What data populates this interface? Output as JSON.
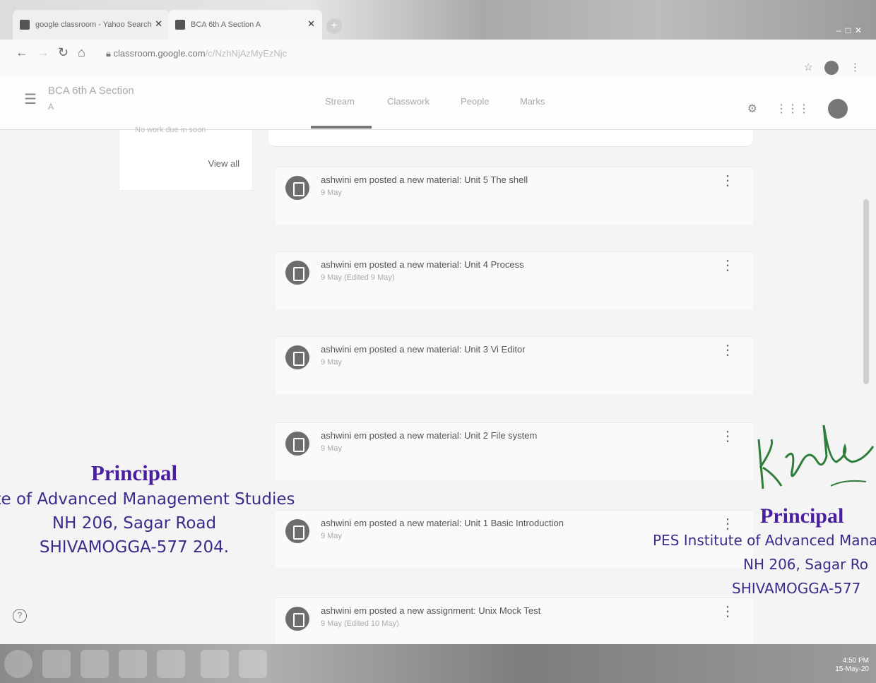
{
  "browser": {
    "tabs": [
      {
        "label": "google classroom - Yahoo Search"
      },
      {
        "label": "BCA 6th A Section A"
      }
    ],
    "url_host": "classroom.google.com",
    "url_path": "/c/NzhNjAzMyEzNjc"
  },
  "header": {
    "class_title": "BCA 6th A Section",
    "class_subtitle": "A",
    "tabs": [
      "Stream",
      "Classwork",
      "People",
      "Marks"
    ]
  },
  "upcoming": {
    "no_work": "No work due in soon",
    "view_all": "View all"
  },
  "posts": [
    {
      "text": "ashwini em posted a new material: Unit 5 The shell",
      "date": "9 May"
    },
    {
      "text": "ashwini em posted a new material: Unit 4 Process",
      "date": "9 May (Edited 9 May)"
    },
    {
      "text": "ashwini em posted a new material: Unit 3 Vi Editor",
      "date": "9 May"
    },
    {
      "text": "ashwini em posted a new material: Unit 2 File system",
      "date": "9 May"
    },
    {
      "text": "ashwini em posted a new material: Unit 1 Basic Introduction",
      "date": "9 May"
    },
    {
      "text": "ashwini em posted a new assignment: Unix Mock Test",
      "date": "9 May (Edited 10 May)"
    }
  ],
  "stamp_left": {
    "title": "Principal",
    "line1": "itute of Advanced Management Studies",
    "line2": "NH 206, Sagar Road",
    "line3": "SHIVAMOGGA-577 204."
  },
  "stamp_right": {
    "title": "Principal",
    "line1": "PES Institute of Advanced Manag",
    "line2": "NH 206, Sagar Ro",
    "line3": "SHIVAMOGGA-577"
  },
  "taskbar": {
    "time": "4:50 PM",
    "date": "15-May-20"
  },
  "colors": {
    "stamp_ink": "#3d2a8a",
    "accent": "#777777"
  }
}
